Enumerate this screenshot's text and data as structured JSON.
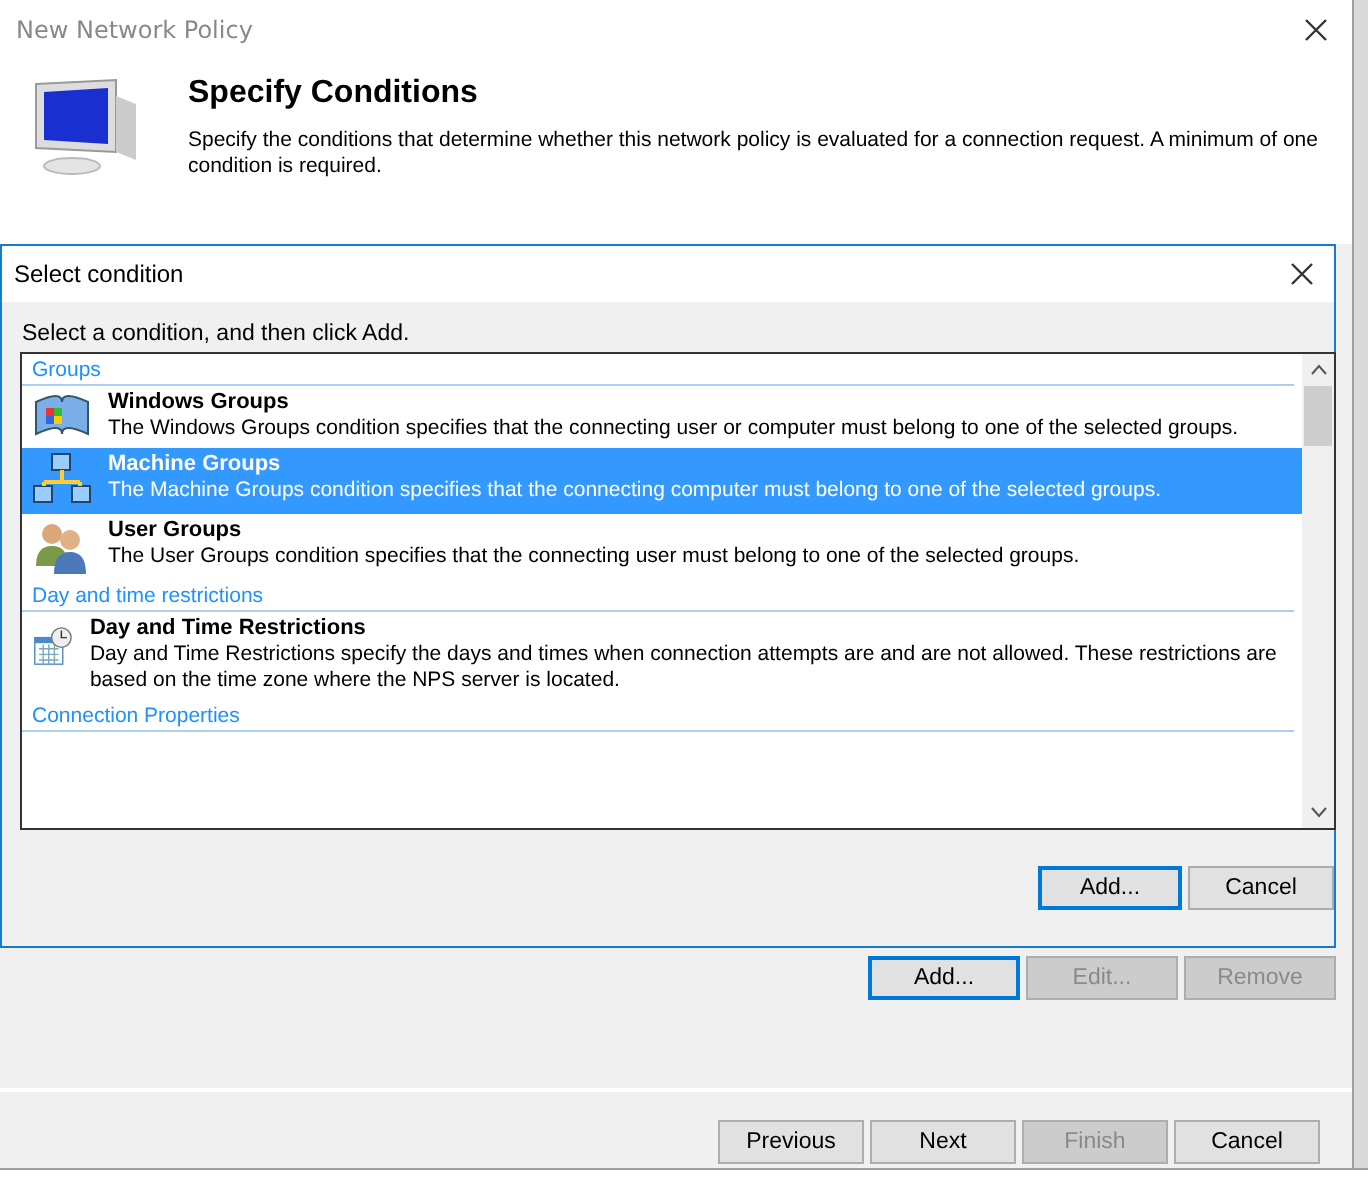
{
  "window": {
    "title": "New Network Policy"
  },
  "header": {
    "title": "Specify Conditions",
    "description": "Specify the conditions that determine whether this network policy is evaluated for a connection request. A minimum of one condition is required."
  },
  "dialog": {
    "title": "Select condition",
    "instruction": "Select a condition, and then click Add.",
    "sections": [
      {
        "heading": "Groups",
        "items": [
          {
            "kind": "windows",
            "name": "Windows Groups",
            "description": "The Windows Groups condition specifies that the connecting user or computer must belong to one of the selected groups.",
            "selected": false
          },
          {
            "kind": "machine",
            "name": "Machine Groups",
            "description": "The Machine Groups condition specifies that the connecting computer must belong to one of the selected groups.",
            "selected": true
          },
          {
            "kind": "users",
            "name": "User Groups",
            "description": "The User Groups condition specifies that the connecting user must belong to one of the selected groups.",
            "selected": false
          }
        ]
      },
      {
        "heading": "Day and time restrictions",
        "items": [
          {
            "kind": "calendar",
            "name": "Day and Time Restrictions",
            "description": "Day and Time Restrictions specify the days and times when connection attempts are and are not allowed. These restrictions are based on the time zone where the NPS server is located.",
            "selected": false
          }
        ]
      },
      {
        "heading": "Connection Properties"
      }
    ],
    "buttons": [
      {
        "label": "Add...",
        "default": true,
        "disabled": false
      },
      {
        "label": "Cancel",
        "default": false,
        "disabled": false
      }
    ]
  },
  "condition_buttons": [
    {
      "label": "Add...",
      "default": true,
      "disabled": false
    },
    {
      "label": "Edit...",
      "default": false,
      "disabled": true
    },
    {
      "label": "Remove",
      "default": false,
      "disabled": true
    }
  ],
  "wizard_buttons": [
    {
      "label": "Previous",
      "default": false,
      "disabled": false
    },
    {
      "label": "Next",
      "default": false,
      "disabled": false
    },
    {
      "label": "Finish",
      "default": false,
      "disabled": true
    },
    {
      "label": "Cancel",
      "default": false,
      "disabled": false
    }
  ]
}
